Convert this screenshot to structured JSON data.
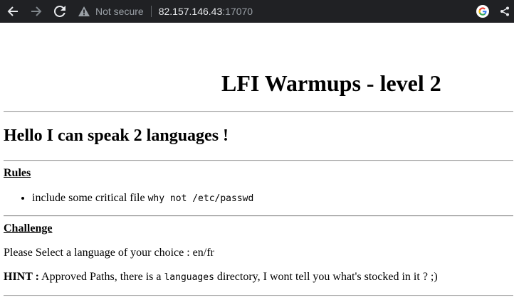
{
  "browser": {
    "security_label": "Not secure",
    "url_host": "82.157.146.43",
    "url_port": ":17070",
    "icons": [
      "back-arrow-icon",
      "forward-arrow-icon",
      "reload-icon",
      "warning-icon",
      "google-icon",
      "share-icon"
    ]
  },
  "page": {
    "title": "LFI Warmups - level 2",
    "heading": "Hello I can speak 2 languages !",
    "rules": {
      "label": "Rules",
      "item_text": "include some critical file ",
      "item_code": "why not /etc/passwd"
    },
    "challenge": {
      "label": "Challenge",
      "prompt": "Please Select a language of your choice : en/fr",
      "hint_label": "HINT :",
      "hint_before": " Approved Paths, there is a ",
      "hint_code": "languages",
      "hint_after": " directory, I wont tell you what's stocked in it ? ;)"
    }
  },
  "colors": {
    "toolbar_bg": "#202124",
    "toolbar_text": "#e8eaed",
    "muted_text": "#9aa0a6"
  }
}
